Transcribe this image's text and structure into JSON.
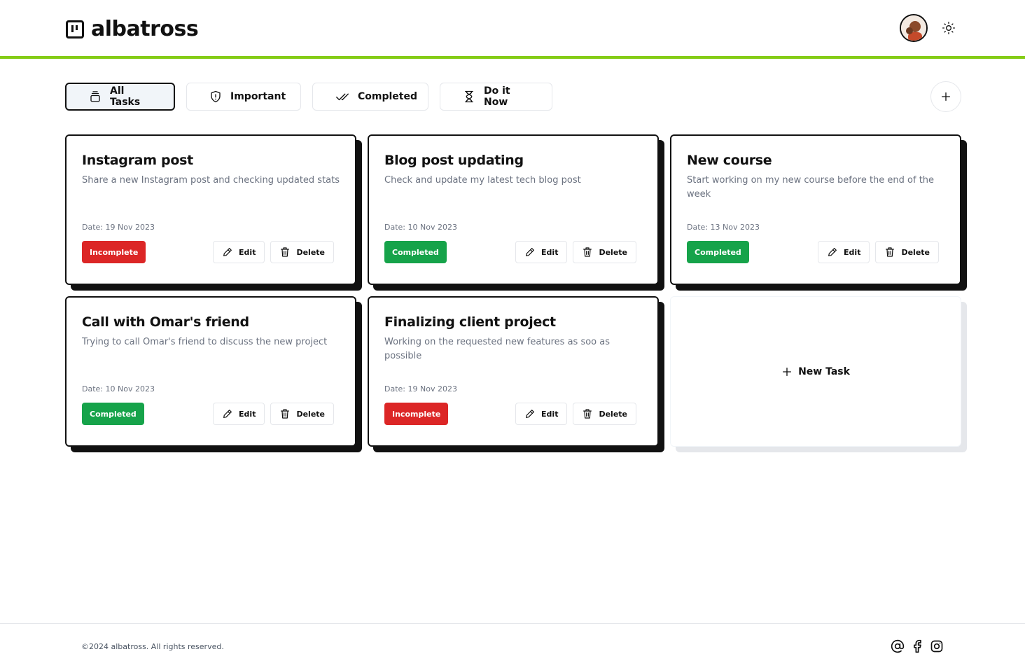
{
  "app": {
    "name": "albatross"
  },
  "header": {
    "avatar_icon": "user-avatar",
    "theme_icon": "sun-icon"
  },
  "tabs": [
    {
      "label": "All Tasks",
      "icon": "layers-icon",
      "active": true
    },
    {
      "label": "Important",
      "icon": "shield-alert-icon",
      "active": false
    },
    {
      "label": "Completed",
      "icon": "double-check-icon",
      "active": false
    },
    {
      "label": "Do it Now",
      "icon": "hourglass-icon",
      "active": false
    }
  ],
  "tasks": [
    {
      "title": "Instagram post",
      "description": "Share a new Instagram post and checking updated stats",
      "date": "Date: 19 Nov 2023",
      "status": "Incomplete"
    },
    {
      "title": "Blog post updating",
      "description": "Check and update my latest tech blog post",
      "date": "Date: 10 Nov 2023",
      "status": "Completed"
    },
    {
      "title": "New course",
      "description": "Start working on my new course before the end of the week",
      "date": "Date: 13 Nov 2023",
      "status": "Completed"
    },
    {
      "title": "Call with Omar's friend",
      "description": "Trying to call Omar's friend to discuss the new project",
      "date": "Date: 10 Nov 2023",
      "status": "Completed"
    },
    {
      "title": "Finalizing client project",
      "description": "Working on the requested new features as soo as possible",
      "date": "Date: 19 Nov 2023",
      "status": "Incomplete"
    }
  ],
  "actions": {
    "edit": "Edit",
    "delete": "Delete"
  },
  "new_task": {
    "label": "New Task"
  },
  "footer": {
    "copyright": "©2024 albatross. All rights reserved.",
    "socials": [
      "at-sign-icon",
      "facebook-icon",
      "instagram-icon"
    ]
  },
  "colors": {
    "accent": "#84cc16",
    "completed": "#16a34a",
    "incomplete": "#dc2626"
  }
}
